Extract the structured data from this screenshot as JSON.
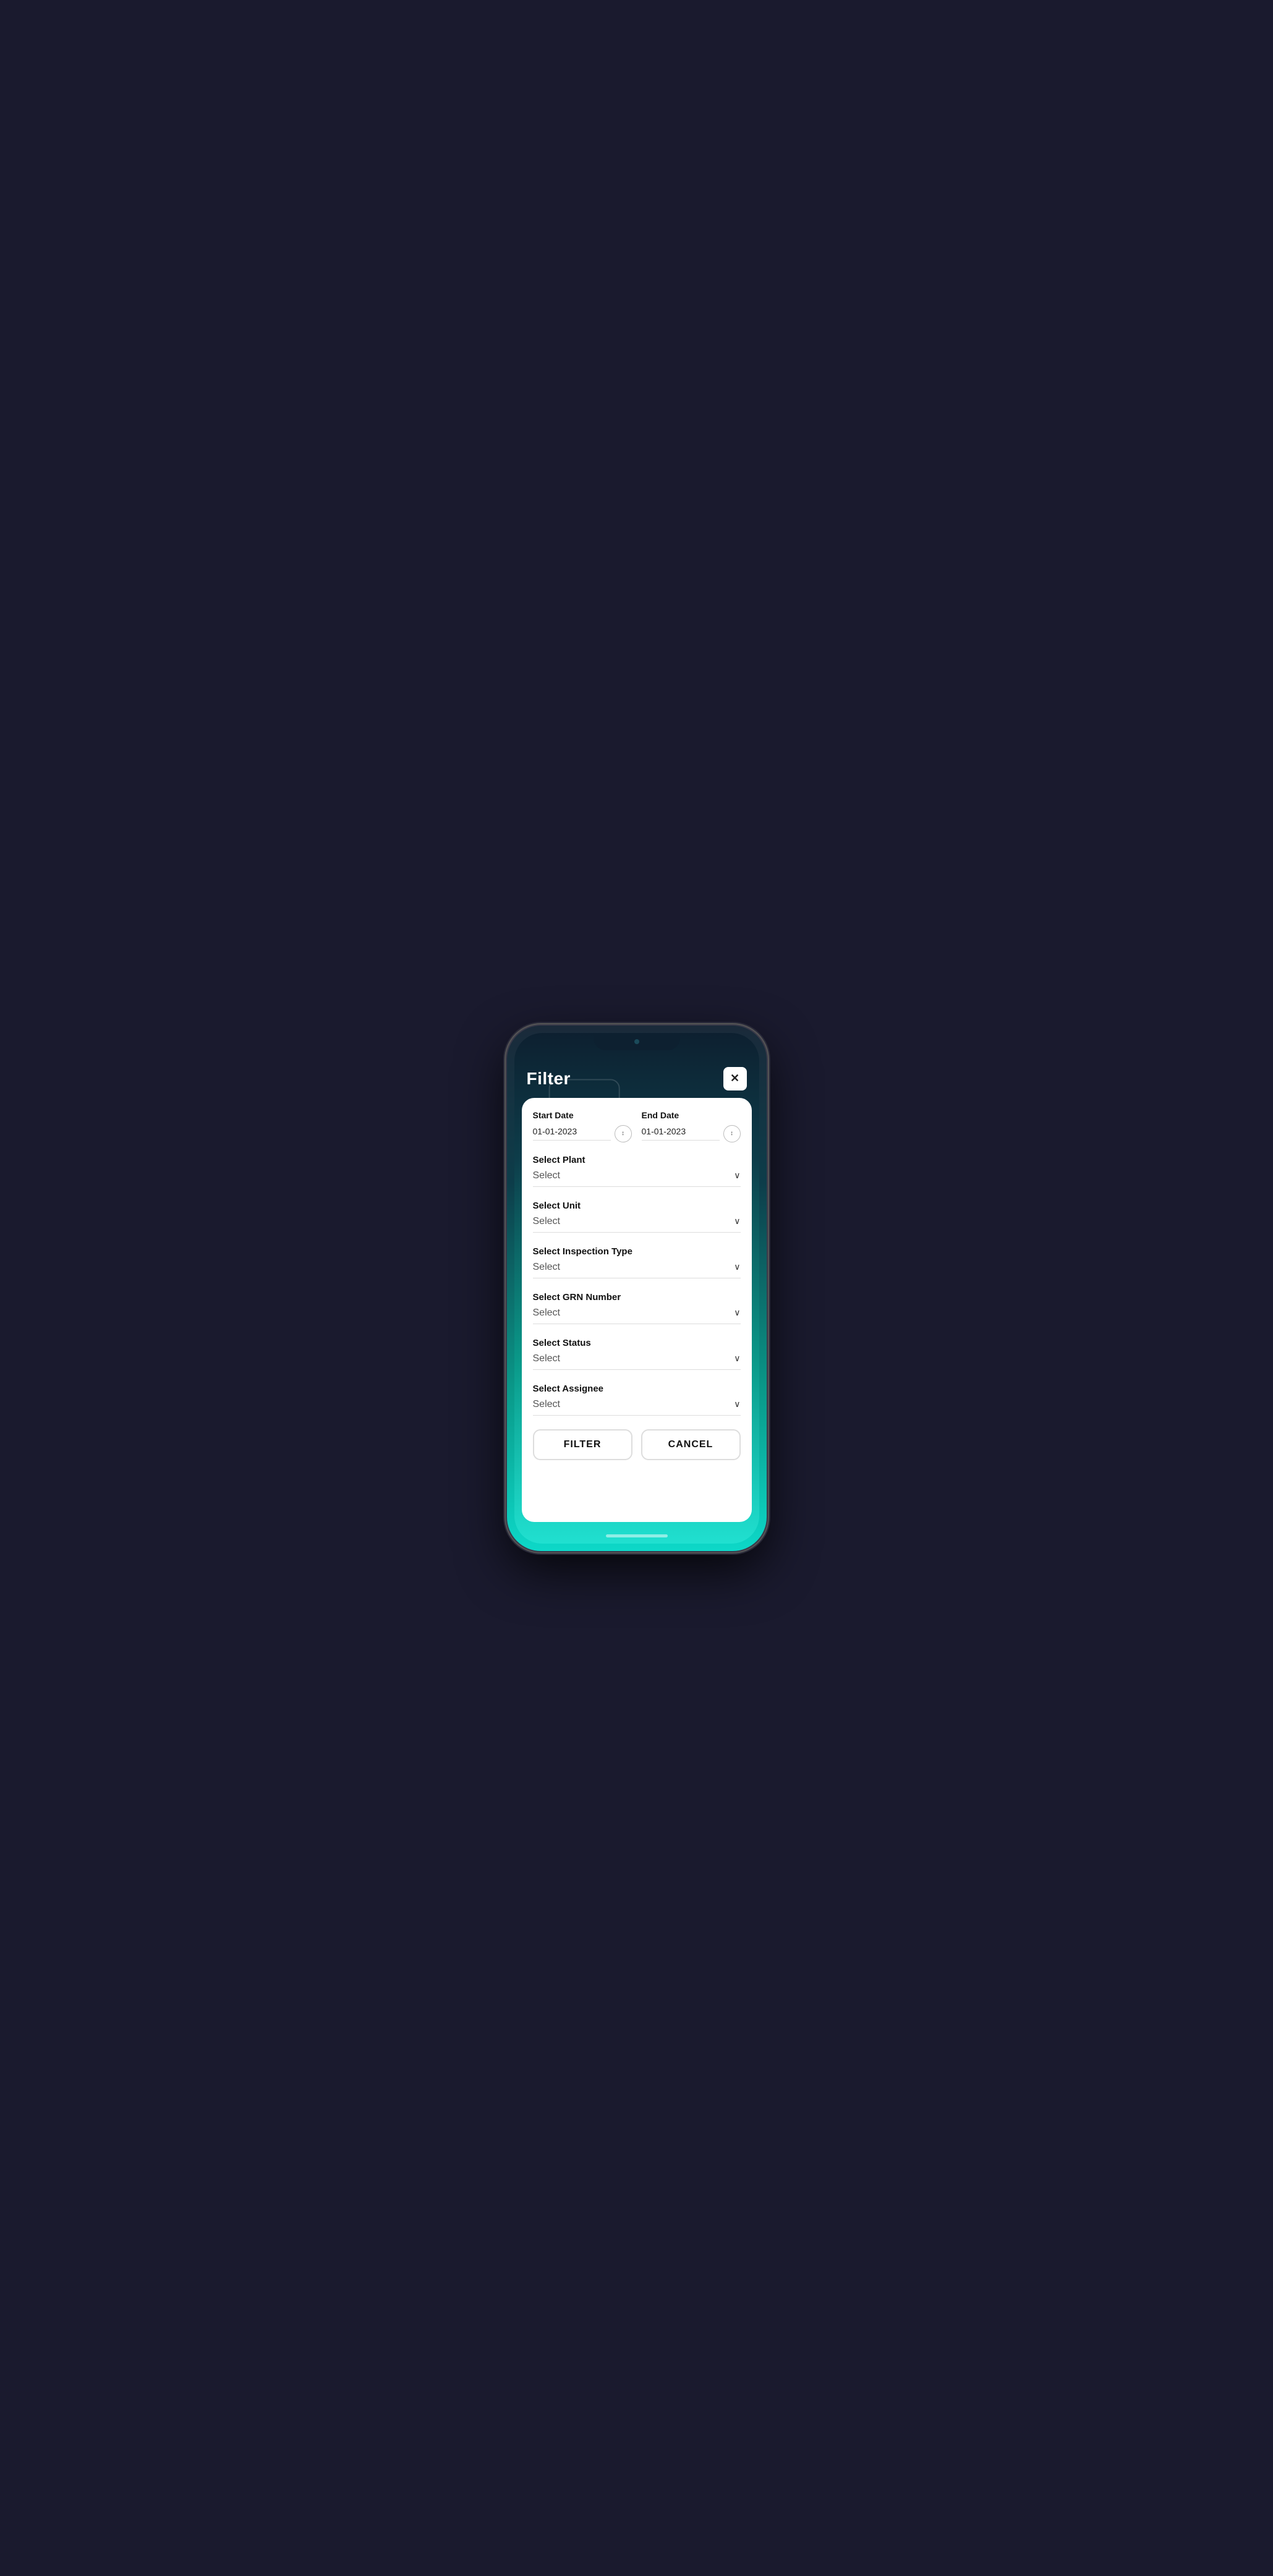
{
  "header": {
    "title": "Filter",
    "close_label": "✕"
  },
  "dates": {
    "start_date_label": "Start Date",
    "start_date_value": "01-01-2023",
    "end_date_label": "End Date",
    "end_date_value": "01-01-2023",
    "sort_icon_symbol": "↕"
  },
  "selects": [
    {
      "id": "plant",
      "label": "Select Plant",
      "value": "Select"
    },
    {
      "id": "unit",
      "label": "Select Unit",
      "value": "Select"
    },
    {
      "id": "inspection-type",
      "label": "Select Inspection Type",
      "value": "Select"
    },
    {
      "id": "grn-number",
      "label": "Select GRN Number",
      "value": "Select"
    },
    {
      "id": "status",
      "label": "Select Status",
      "value": "Select"
    },
    {
      "id": "assignee",
      "label": "Select Assignee",
      "value": "Select"
    }
  ],
  "buttons": {
    "filter_label": "FILTER",
    "cancel_label": "CANCEL"
  },
  "chevron": "∨"
}
